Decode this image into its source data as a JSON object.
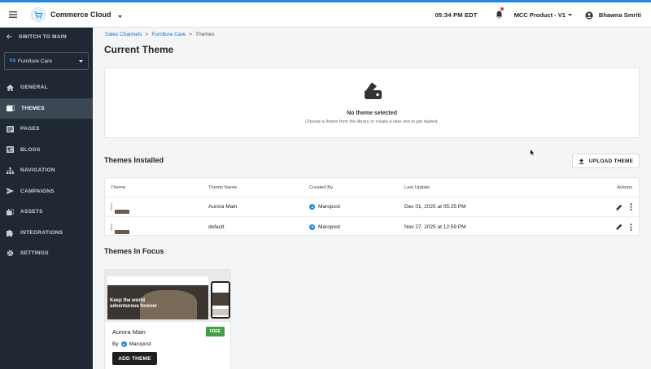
{
  "app": {
    "title": "Commerce Cloud"
  },
  "header": {
    "time": "05:34 PM EDT",
    "store_name": "MCC Product - V1",
    "user_name": "Bhawna Smriti"
  },
  "sidebar": {
    "switch_label": "SWITCH TO MAIN",
    "store_badge": "FS",
    "store_label": "Furniture Care",
    "items": [
      {
        "label": "GENERAL",
        "icon": "home-icon"
      },
      {
        "label": "THEMES",
        "icon": "themes-icon",
        "active": true
      },
      {
        "label": "PAGES",
        "icon": "pages-icon"
      },
      {
        "label": "BLOGS",
        "icon": "blogs-icon"
      },
      {
        "label": "NAVIGATION",
        "icon": "sitemap-icon"
      },
      {
        "label": "CAMPAIGNS",
        "icon": "send-icon"
      },
      {
        "label": "ASSETS",
        "icon": "assets-icon"
      },
      {
        "label": "INTEGRATIONS",
        "icon": "puzzle-icon"
      },
      {
        "label": "SETTINGS",
        "icon": "gear-icon"
      }
    ]
  },
  "breadcrumb": [
    "Sales Channels",
    "Furniture Care",
    "Themes"
  ],
  "page_title": "Current Theme",
  "current_theme": {
    "empty_title": "No theme selected",
    "empty_subtitle": "Choose a theme from the library or create a new one to get started."
  },
  "installed": {
    "title": "Themes Installed",
    "upload_label": "UPLOAD THEME",
    "columns": [
      "Theme",
      "Theme Name",
      "Created By",
      "Last Update",
      "Actions"
    ],
    "rows": [
      {
        "name": "Aurora Main",
        "created_by": "Maropost",
        "last_update": "Dec 01, 2025 at 05:25 PM"
      },
      {
        "name": "default",
        "created_by": "Maropost",
        "last_update": "Nov 27, 2025 at 12:59 PM"
      }
    ]
  },
  "focus": {
    "title": "Themes In Focus",
    "card": {
      "hero_text": "Keep the world adventurous forever",
      "name": "Aurora Main",
      "badge": "FREE",
      "by_label": "By",
      "author": "Maropost",
      "add_label": "ADD THEME"
    }
  },
  "colors": {
    "accent": "#1e88e5",
    "sidebar_bg": "#1f2833",
    "free": "#43a047"
  }
}
